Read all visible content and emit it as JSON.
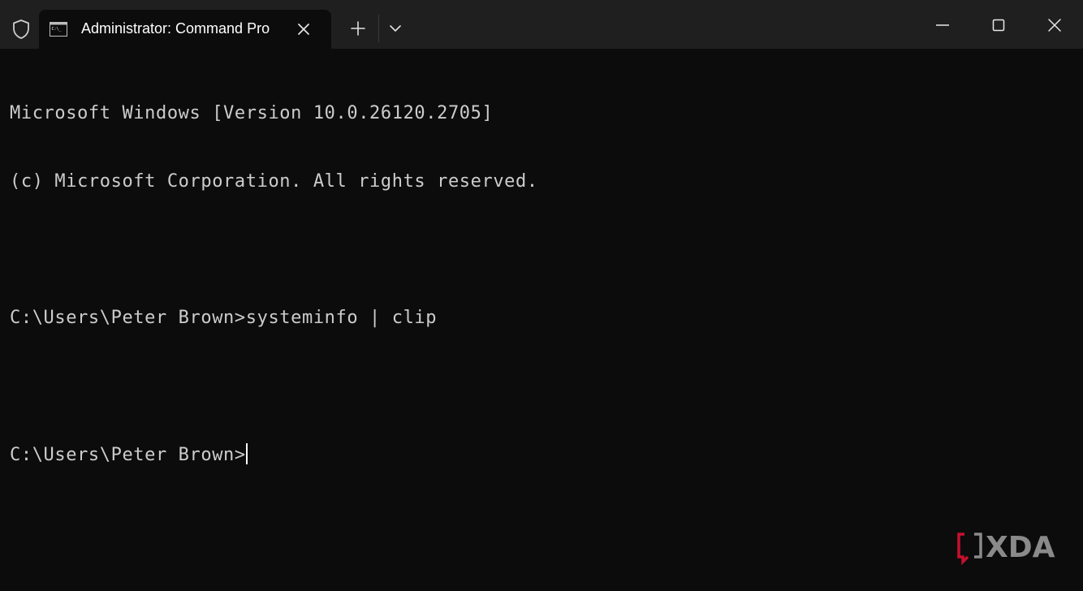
{
  "tab": {
    "title": "Administrator: Command Pro"
  },
  "titlebar": {
    "icons": {
      "shield": "shield-icon",
      "terminal": "cmd-terminal-icon",
      "close_tab": "close-icon",
      "new_tab": "plus-icon",
      "dropdown": "chevron-down-icon",
      "minimize": "minimize-icon",
      "maximize": "maximize-icon",
      "close_window": "close-icon"
    }
  },
  "terminal": {
    "lines": [
      "Microsoft Windows [Version 10.0.26120.2705]",
      "(c) Microsoft Corporation. All rights reserved.",
      "",
      "C:\\Users\\Peter Brown>systeminfo | clip",
      "",
      "C:\\Users\\Peter Brown>"
    ]
  },
  "watermark": {
    "text": "XDA"
  },
  "colors": {
    "background": "#0c0c0c",
    "titlebar": "#1f1f1f",
    "text": "#cccccc",
    "watermark_red": "#c8102e"
  }
}
